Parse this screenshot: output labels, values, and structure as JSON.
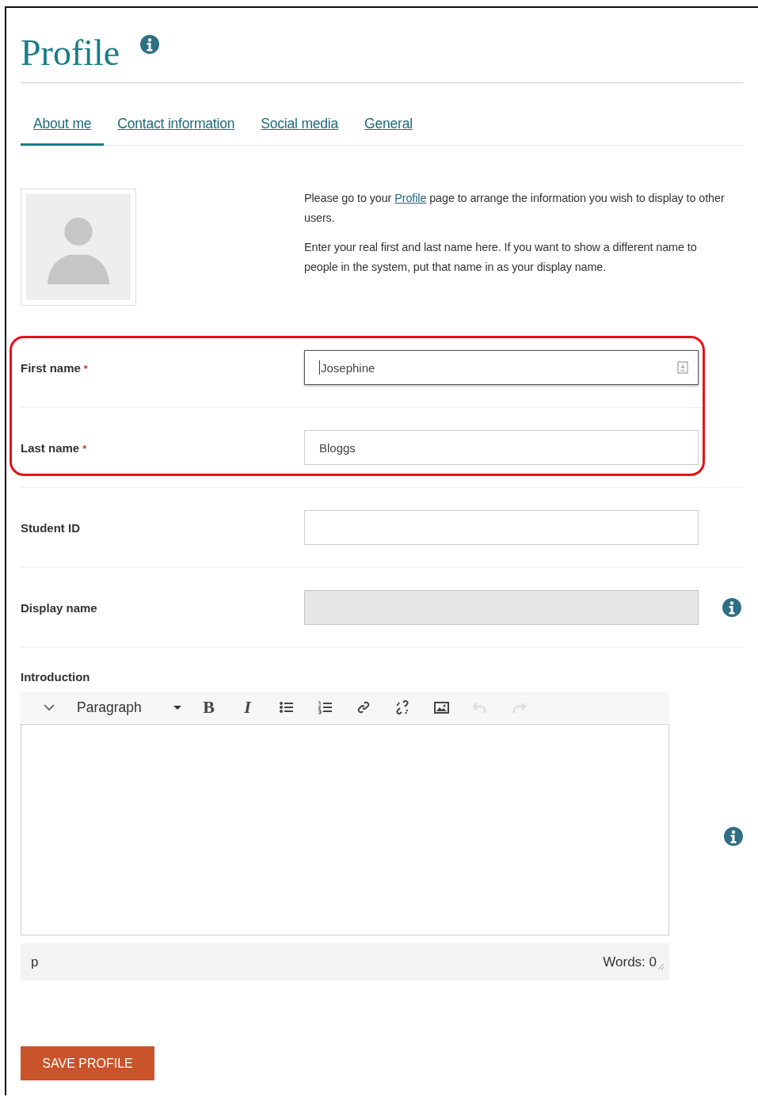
{
  "header": {
    "title": "Profile",
    "help": true
  },
  "tabs": [
    {
      "label": "About me",
      "selected": true
    },
    {
      "label": "Contact information",
      "selected": false
    },
    {
      "label": "Social media",
      "selected": false
    },
    {
      "label": "General",
      "selected": false
    }
  ],
  "intro": {
    "avatar": true,
    "paragraphs": [
      {
        "before": "Please go to your ",
        "link": "Profile",
        "after": " page to arrange the information you wish to display to other users."
      },
      {
        "before": "Enter your real first and last name here. If you want to show a different name to people in the system, put that name in as your display name."
      }
    ]
  },
  "fields": [
    {
      "label": "First name",
      "required_mark": "*",
      "value": "Josephine",
      "focused": true,
      "disabled": false,
      "help": false,
      "highlighted": true
    },
    {
      "label": "Last name",
      "required_mark": "*",
      "value": "Bloggs",
      "focused": false,
      "disabled": false,
      "help": false,
      "highlighted": true
    },
    {
      "label": "Student ID",
      "focused": false,
      "disabled": false,
      "help": false,
      "highlighted": false
    },
    {
      "label": "Display name",
      "focused": false,
      "disabled": true,
      "help": true,
      "highlighted": false
    }
  ],
  "editor": {
    "label": "Introduction",
    "help": true,
    "toolbar": [
      {
        "kind": "collapse",
        "disabled": false
      },
      {
        "kind": "format",
        "label": "Paragraph",
        "disabled": false
      },
      {
        "kind": "bold",
        "label": "B",
        "disabled": false
      },
      {
        "kind": "italic",
        "label": "I",
        "disabled": false
      },
      {
        "kind": "bullets",
        "disabled": false
      },
      {
        "kind": "numbers",
        "disabled": false
      },
      {
        "kind": "link",
        "disabled": false
      },
      {
        "kind": "unlink",
        "disabled": false
      },
      {
        "kind": "image",
        "disabled": false
      },
      {
        "kind": "undo",
        "disabled": true
      },
      {
        "kind": "redo",
        "disabled": true
      }
    ],
    "path": "p",
    "word_count": "Words: 0"
  },
  "save_button": "SAVE PROFILE"
}
